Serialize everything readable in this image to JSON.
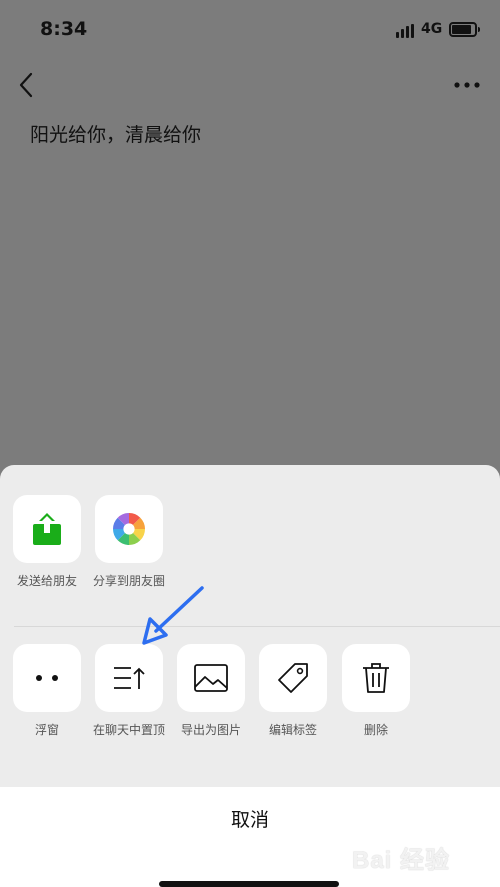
{
  "status_bar": {
    "time": "8:34",
    "network": "4G"
  },
  "note": {
    "title": "阳光给你，清晨给你"
  },
  "sheet": {
    "share_actions": [
      {
        "label": "发送给朋友",
        "icon": "send-to-friend-icon",
        "color": "#1aad19"
      },
      {
        "label": "分享到朋友圈",
        "icon": "moments-icon"
      }
    ],
    "more_actions": [
      {
        "label": "浮窗",
        "icon": "floating-window-icon"
      },
      {
        "label": "在聊天中置顶",
        "icon": "pin-to-chat-icon"
      },
      {
        "label": "导出为图片",
        "icon": "export-image-icon"
      },
      {
        "label": "编辑标签",
        "icon": "tag-icon"
      },
      {
        "label": "删除",
        "icon": "trash-icon"
      }
    ],
    "cancel_label": "取消"
  },
  "annotation": {
    "arrow_color": "#2d6ef0"
  },
  "watermark": {
    "text": "Bai 经验"
  }
}
